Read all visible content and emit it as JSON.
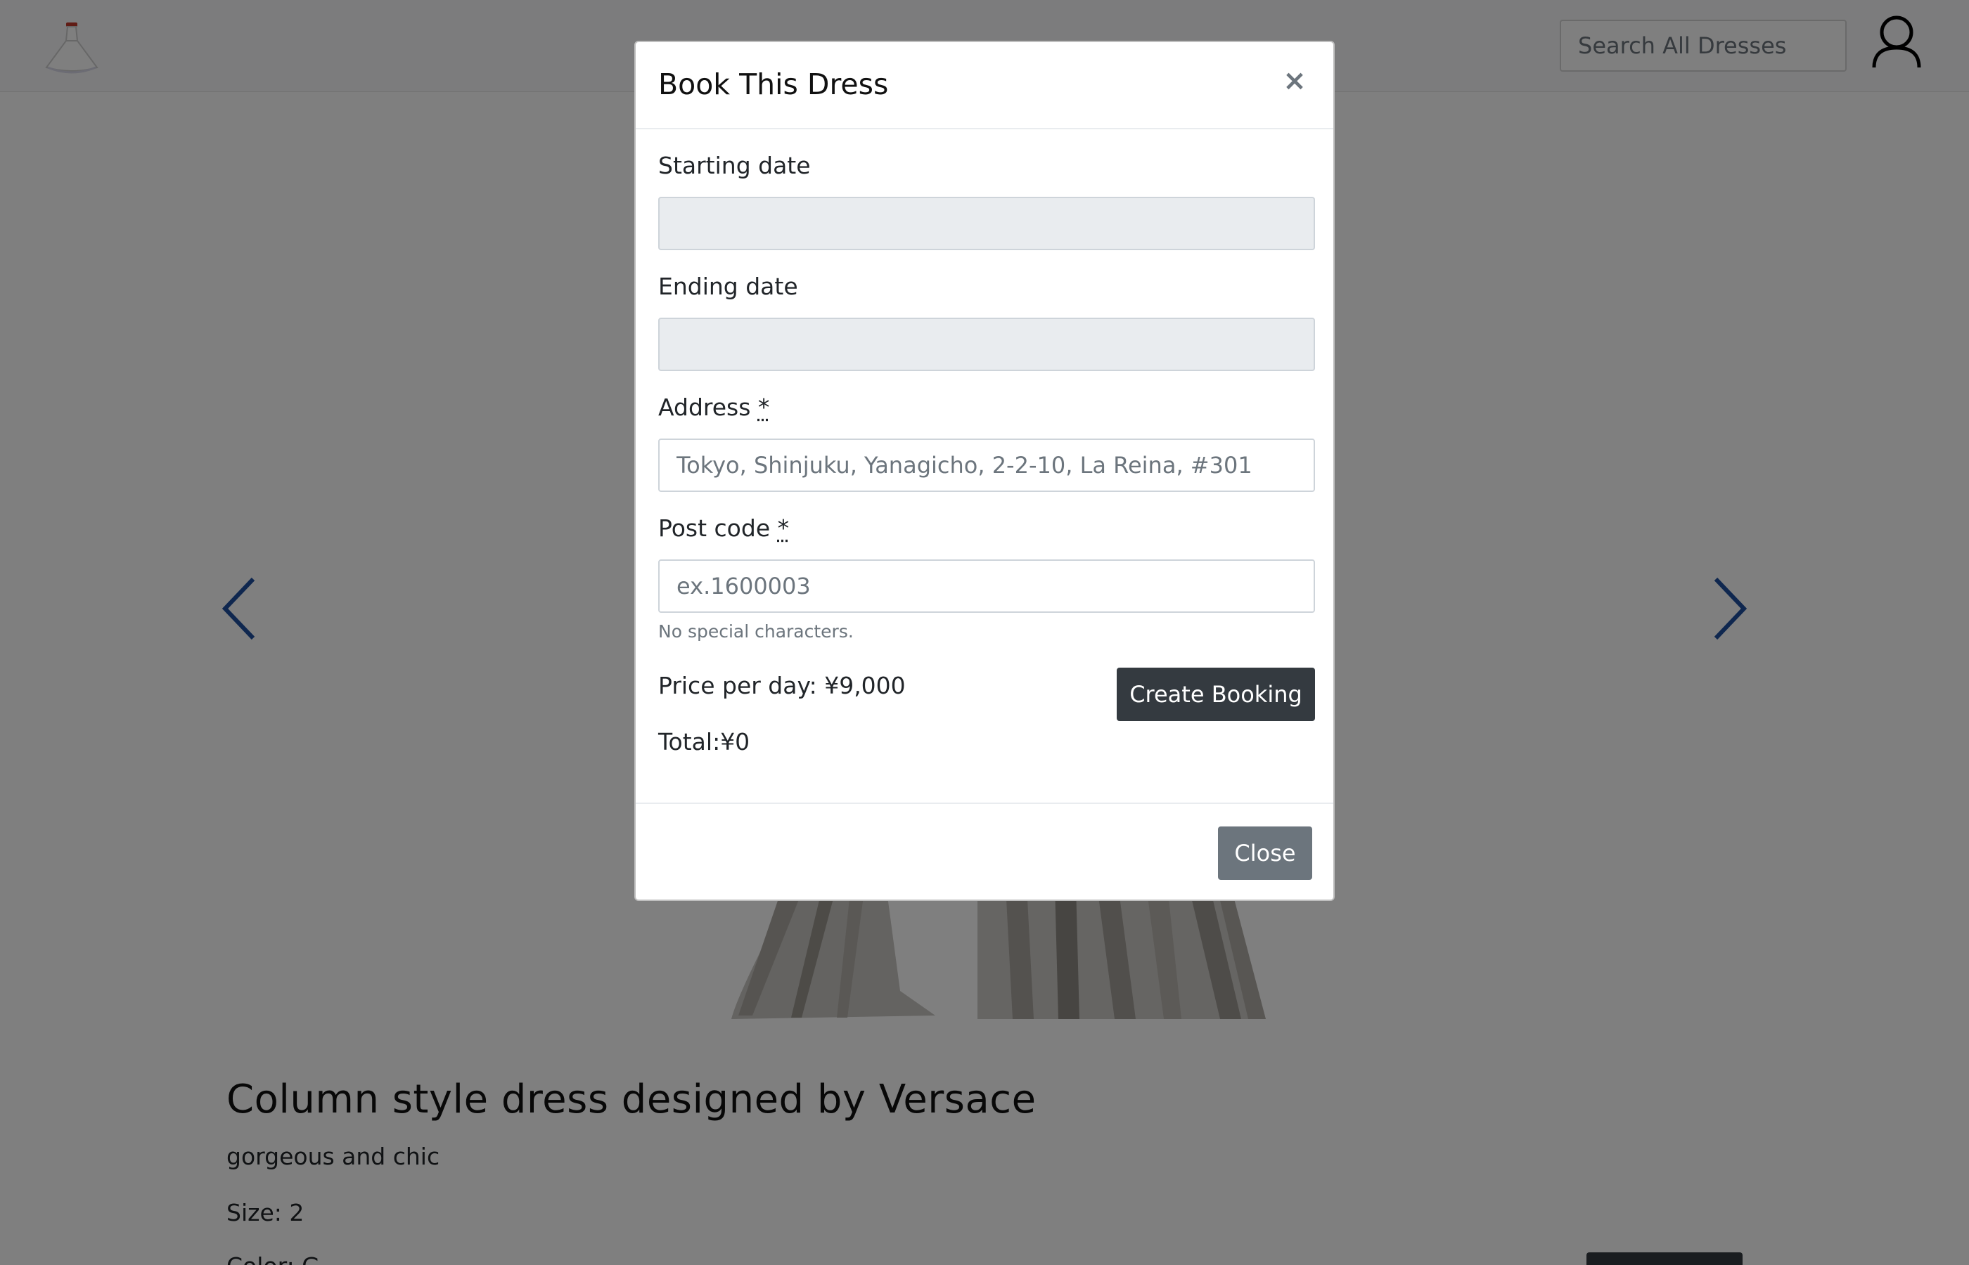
{
  "navbar": {
    "logo_icon": "dress-logo-icon",
    "search_placeholder": "Search All Dresses",
    "user_icon": "user-account-icon"
  },
  "carousel": {
    "prev_icon": "chevron-left-icon",
    "next_icon": "chevron-right-icon",
    "accent_color": "#1f4e9e"
  },
  "dress": {
    "title": "Column style dress designed by Versace",
    "description": "gorgeous and chic",
    "size_text": "Size: 2",
    "color_text": "Color: G"
  },
  "modal": {
    "title": "Book This Dress",
    "close_symbol": "×",
    "fields": {
      "start_date": {
        "label": "Starting date",
        "value": ""
      },
      "end_date": {
        "label": "Ending date",
        "value": ""
      },
      "address": {
        "label": "Address",
        "required_mark": "*",
        "placeholder": "Tokyo, Shinjuku, Yanagicho, 2-2-10, La Reina, #301",
        "value": ""
      },
      "post_code": {
        "label": "Post code",
        "required_mark": "*",
        "placeholder": "ex.1600003",
        "value": "",
        "help": "No special characters."
      }
    },
    "price_per_day": "Price per day: ¥9,000",
    "total": "Total:¥0",
    "create_booking_label": "Create Booking",
    "close_label": "Close"
  },
  "colors": {
    "dark_button": "#343a40",
    "secondary_button": "#6c757d",
    "overlay": "rgba(0,0,0,0.5)"
  }
}
